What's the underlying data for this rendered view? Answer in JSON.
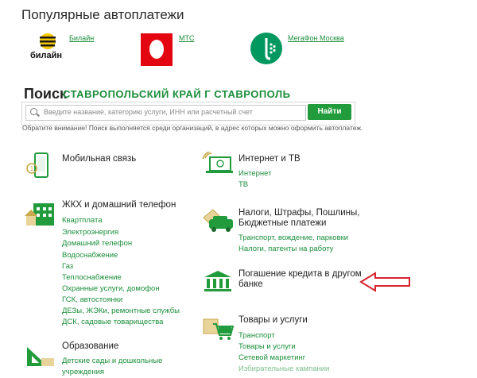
{
  "autopay": {
    "heading": "Популярные автоплатежи",
    "providers": [
      {
        "label": "Билайн",
        "logo_text": "билайн"
      },
      {
        "label": "МТС"
      },
      {
        "label": "МегаФон Москва"
      }
    ]
  },
  "search": {
    "title": "Поиск",
    "region": "СТАВРОПОЛЬСКИЙ КРАЙ Г СТАВРОПОЛЬ",
    "placeholder": "Введите название, категорию услуги, ИНН или расчетный счет",
    "button": "Найти",
    "notice": "Обратите внимание! Поиск выполняется среди организаций, в адрес которых можно оформить автоплатеж."
  },
  "categories": {
    "mobile": {
      "title": "Мобильная связь"
    },
    "internet": {
      "title": "Интернет и ТВ",
      "links": [
        "Интернет",
        "ТВ"
      ]
    },
    "housing": {
      "title": "ЖКХ и домашний телефон",
      "links": [
        "Квартплата",
        "Электроэнергия",
        "Домашний телефон",
        "Водоснабжение",
        "Газ",
        "Теплоснабжение",
        "Охранные услуги, домофон",
        "ГСК, автостоянки",
        "ДЕЗы, ЖЭКи, ремонтные службы",
        "ДСК, садовые товарищества"
      ]
    },
    "taxes": {
      "title_line1": "Налоги, Штрафы, Пошлины,",
      "title_line2": "Бюджетные платежи",
      "links": [
        "Транспорт, вождение, парковки",
        "Налоги, патенты на работу"
      ]
    },
    "loan": {
      "title_line1": "Погашение кредита в другом",
      "title_line2": "банке"
    },
    "goods": {
      "title": "Товары и услуги",
      "links": [
        "Транспорт",
        "Товары и услуги",
        "Сетевой маркетинг",
        "Избирательные кампании"
      ]
    },
    "education": {
      "title": "Образование",
      "links": [
        "Детские сады и дошкольные",
        "учреждения"
      ]
    }
  },
  "colors": {
    "green": "#219b3c",
    "link_green": "#1b8e3a",
    "mts_red": "#e30611",
    "megafon_green": "#00985f",
    "arrow_red": "#d9232d"
  }
}
